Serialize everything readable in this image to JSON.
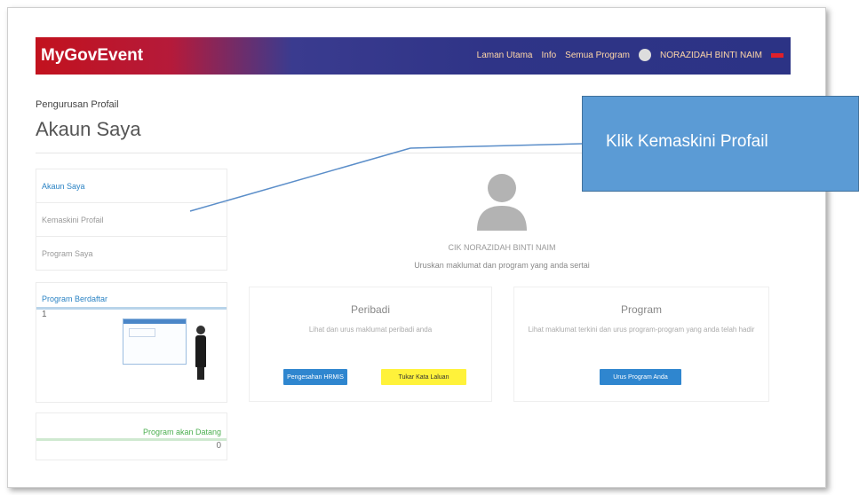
{
  "navbar": {
    "brand": "MyGovEvent",
    "links": [
      "Laman Utama",
      "Info",
      "Semua Program"
    ],
    "user": "NORAZIDAH BINTI NAIM"
  },
  "breadcrumb": "Pengurusan Profail",
  "page_title": "Akaun Saya",
  "sidebar": {
    "menu": [
      "Akaun Saya",
      "Kemaskini Profail",
      "Program Saya"
    ],
    "registered": {
      "title": "Program Berdaftar",
      "count": "1"
    },
    "upcoming": {
      "title": "Program akan Datang",
      "count": "0"
    }
  },
  "profile": {
    "name": "CIK NORAZIDAH BINTI NAIM",
    "description": "Uruskan maklumat dan program yang anda sertai"
  },
  "cards": {
    "personal": {
      "title": "Peribadi",
      "description": "Lihat dan urus maklumat peribadi anda",
      "button_hrmis": "Pengesahan HRMIS",
      "button_password": "Tukar Kata Laluan"
    },
    "program": {
      "title": "Program",
      "description": "Lihat maklumat terkini dan urus program-program yang anda telah hadir",
      "button": "Urus Program Anda"
    }
  },
  "callout": {
    "text": "Klik  Kemaskini Profail"
  },
  "colors": {
    "accent": "#2f86cf",
    "callout": "#5b9bd5",
    "navbar_red": "#c2121e",
    "navbar_blue": "#2f3487"
  }
}
